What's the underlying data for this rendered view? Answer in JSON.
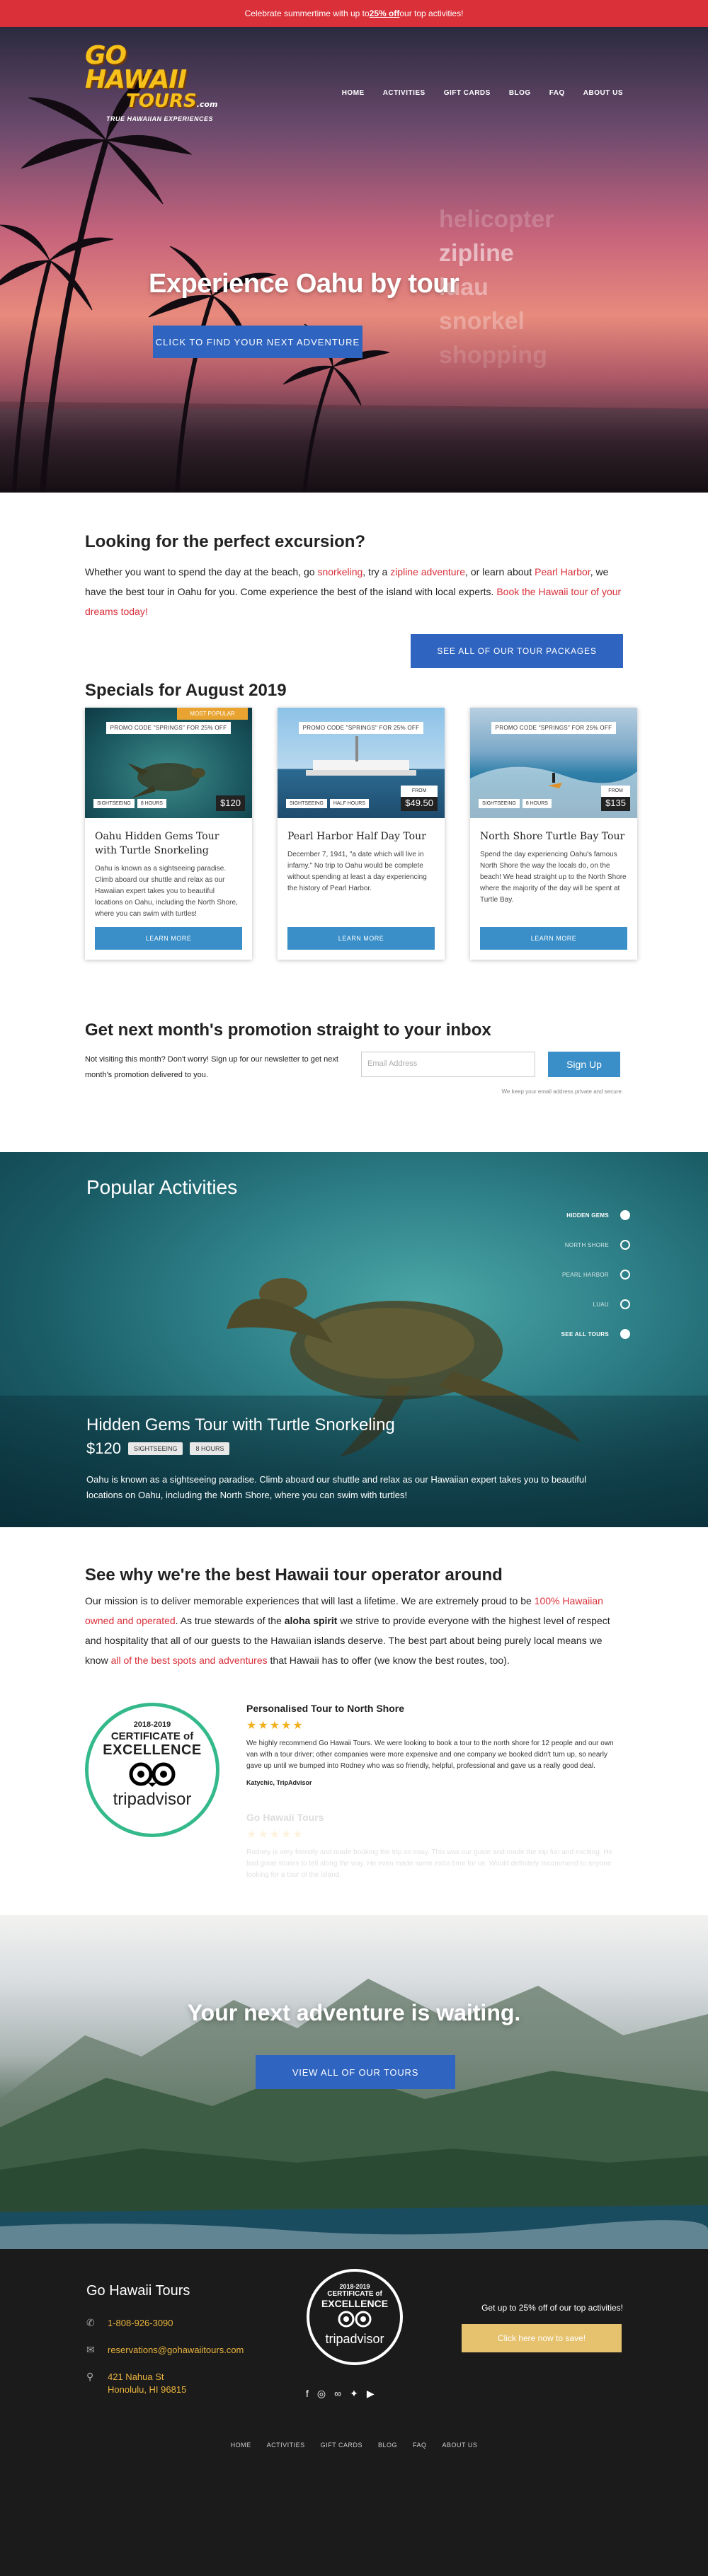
{
  "promo_bar": {
    "before": "Celebrate summertime with up to ",
    "highlight": "25% off",
    "after": " our top activities!"
  },
  "logo": {
    "line1": "GO HAWAII",
    "line2": "TOURS",
    "suffix": ".com",
    "tagline": "TRUE HAWAIIAN EXPERIENCES"
  },
  "nav": [
    "HOME",
    "ACTIVITIES",
    "GIFT CARDS",
    "BLOG",
    "FAQ",
    "ABOUT US"
  ],
  "hero": {
    "title": "Experience Oahu by tour",
    "cta": "CLICK TO FIND YOUR NEXT ADVENTURE",
    "rolling_words": [
      "helicopter",
      "zipline",
      "luau",
      "snorkel",
      "shopping"
    ]
  },
  "intro": {
    "title": "Looking for the perfect excursion?",
    "p_parts": [
      "Whether you want to spend the day at the beach, go ",
      "snorkeling",
      ", try a ",
      "zipline adventure",
      ", or learn about ",
      "Pearl Harbor",
      ", we have the best tour in Oahu for you. Come experience the best of the island with local experts. ",
      "Book the Hawaii tour of your dreams today!"
    ],
    "button": "SEE ALL OF OUR TOUR PACKAGES"
  },
  "specials": {
    "title": "Specials for August 2019",
    "cards": [
      {
        "code": "PROMO CODE \"SPRINGS\" FOR 25% OFF",
        "tag": "MOST POPULAR",
        "chip1": "SIGHTSEEING",
        "chip2": "8 HOURS",
        "price": "$120",
        "price_note": "",
        "title": "Oahu Hidden Gems Tour with Turtle Snorkeling",
        "desc": "Oahu is known as a sightseeing paradise. Climb aboard our shuttle and relax as our Hawaiian expert takes you to beautiful locations on Oahu, including the North Shore, where you can swim with turtles!",
        "button": "LEARN MORE"
      },
      {
        "code": "PROMO CODE \"SPRINGS\" FOR 25% OFF",
        "tag": "",
        "chip1": "SIGHTSEEING",
        "chip2": "HALF HOURS",
        "price": "$49.50",
        "price_note": "FROM",
        "title": "Pearl Harbor Half Day Tour",
        "desc": "December 7, 1941, \"a date which will live in infamy.\" No trip to Oahu would be complete without spending at least a day experiencing the history of Pearl Harbor.",
        "button": "LEARN MORE"
      },
      {
        "code": "PROMO CODE \"SPRINGS\" FOR 25% OFF",
        "tag": "",
        "chip1": "SIGHTSEEING",
        "chip2": "8 HOURS",
        "price": "$135",
        "price_note": "FROM",
        "title": "North Shore Turtle Bay Tour",
        "desc": "Spend the day experiencing Oahu's famous North Shore the way the locals do, on the beach! We head straight up to the North Shore where the majority of the day will be spent at Turtle Bay.",
        "button": "LEARN MORE"
      }
    ]
  },
  "newsletter": {
    "title": "Get next month's promotion straight to your inbox",
    "desc": "Not visiting this month? Don't worry! Sign up for our newsletter to get next month's promotion delivered to you.",
    "placeholder": "Email Address",
    "button": "Sign Up",
    "privacy": "We keep your email address private and secure."
  },
  "popular": {
    "title": "Popular Activities",
    "nav": [
      "HIDDEN GEMS",
      "NORTH SHORE",
      "PEARL HARBOR",
      "LUAU",
      "SEE ALL TOURS"
    ],
    "tour_title": "Hidden Gems Tour with Turtle Snorkeling",
    "price": "$120",
    "pill1": "SIGHTSEEING",
    "pill2": "8 HOURS",
    "desc": "Oahu is known as a sightseeing paradise. Climb aboard our shuttle and relax as our Hawaiian expert takes you to beautiful locations on Oahu, including the North Shore, where you can swim with turtles!"
  },
  "why": {
    "title": "See why we're the best Hawaii tour operator around",
    "p_parts": [
      "Our mission is to deliver memorable experiences that will last a lifetime. We are extremely proud to be ",
      "100% Hawaiian owned and operated",
      ". As true stewards of the ",
      "aloha spirit",
      " we strive to provide everyone with the highest level of respect and hospitality that all of our guests to the Hawaiian islands deserve. The best part about being purely local means we know ",
      "all of the best spots and adventures",
      " that Hawaii has to offer (we know the best routes, too)."
    ]
  },
  "badge": {
    "year": "2018-2019",
    "line1": "CERTIFICATE of",
    "line2": "EXCELLENCE",
    "brand": "tripadvisor"
  },
  "reviews": [
    {
      "title": "Personalised Tour to North Shore",
      "stars": "★★★★★",
      "text": "We highly recommend Go Hawaii Tours. We were looking to book a tour to the north shore for 12 people and our own van with a tour driver; other companies were more expensive and one company we booked didn't turn up, so nearly gave up until we bumped into Rodney who was so friendly, helpful, professional and gave us a really good deal.",
      "author": "Katychic, TripAdvisor"
    },
    {
      "title": "Go Hawaii Tours",
      "stars": "★★★★★",
      "text": "Rodney is very friendly and made booking the trip so easy. This was our guide and made the trip fun and exciting. He had great stories to tell along the way. He even made some extra time for us. Would definitely recommend to anyone looking for a tour of the island.",
      "author": ""
    }
  ],
  "adventure": {
    "title": "Your next adventure is waiting.",
    "button": "VIEW ALL OF OUR TOURS"
  },
  "footer": {
    "brand": "Go Hawaii Tours",
    "phone": "1-808-926-3090",
    "email": "reservations@gohawaiitours.com",
    "address1": "421 Nahua St",
    "address2": "Honolulu, HI   96815",
    "save_text": "Get up to 25% off of our top activities!",
    "save_button": "Click here now to save!",
    "nav": [
      "HOME",
      "ACTIVITIES",
      "GIFT CARDS",
      "BLOG",
      "FAQ",
      "ABOUT US"
    ]
  },
  "colors": {
    "accent_red": "#d9303a",
    "primary_blue": "#2f64c0",
    "button_blue": "#3a8fc8",
    "gold": "#e6c16e",
    "tripadvisor_green": "#34b98a"
  }
}
